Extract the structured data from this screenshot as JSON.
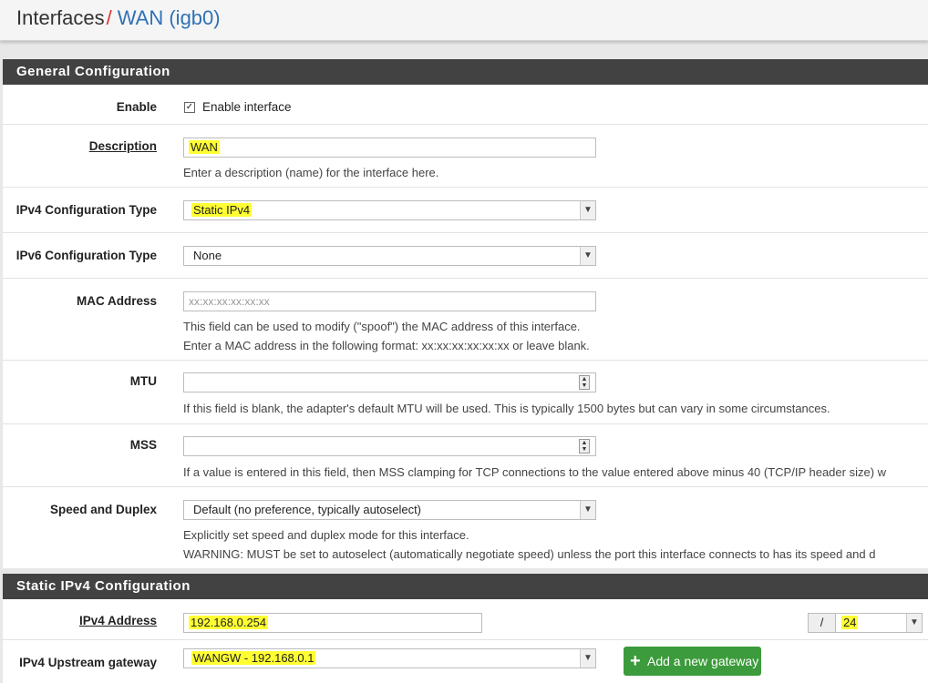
{
  "header": {
    "section": "Interfaces",
    "separator": "/",
    "page": "WAN (igb0)"
  },
  "general": {
    "heading": "General Configuration",
    "enable": {
      "label": "Enable",
      "checkbox_text": "Enable interface",
      "checked": true
    },
    "description": {
      "label": "Description",
      "value": "WAN",
      "help": "Enter a description (name) for the interface here."
    },
    "ipv4_type": {
      "label": "IPv4 Configuration Type",
      "value": "Static IPv4"
    },
    "ipv6_type": {
      "label": "IPv6 Configuration Type",
      "value": "None"
    },
    "mac": {
      "label": "MAC Address",
      "placeholder": "xx:xx:xx:xx:xx:xx",
      "help1": "This field can be used to modify (\"spoof\") the MAC address of this interface.",
      "help2": "Enter a MAC address in the following format: xx:xx:xx:xx:xx:xx or leave blank."
    },
    "mtu": {
      "label": "MTU",
      "value": "",
      "help": "If this field is blank, the adapter's default MTU will be used. This is typically 1500 bytes but can vary in some circumstances."
    },
    "mss": {
      "label": "MSS",
      "value": "",
      "help": "If a value is entered in this field, then MSS clamping for TCP connections to the value entered above minus 40 (TCP/IP header size) w"
    },
    "speed": {
      "label": "Speed and Duplex",
      "value": "Default (no preference, typically autoselect)",
      "help1": "Explicitly set speed and duplex mode for this interface.",
      "help2": "WARNING: MUST be set to autoselect (automatically negotiate speed) unless the port this interface connects to has its speed and d"
    }
  },
  "static_ipv4": {
    "heading": "Static IPv4 Configuration",
    "address": {
      "label": "IPv4 Address",
      "value": "192.168.0.254",
      "slash": "/",
      "cidr": "24"
    },
    "gateway": {
      "label": "IPv4 Upstream gateway",
      "value": "WANGW - 192.168.0.1",
      "add_button": "Add a new gateway"
    }
  },
  "icons": {
    "select_arrow": "chevron-down-icon",
    "plus": "plus-icon",
    "spinner": "spinner-icon",
    "check": "check-icon"
  },
  "colors": {
    "heading_bg": "#424242",
    "link": "#3071b5",
    "separator": "#e03030",
    "highlight": "#ffff33",
    "button_green": "#3c9b3c"
  }
}
